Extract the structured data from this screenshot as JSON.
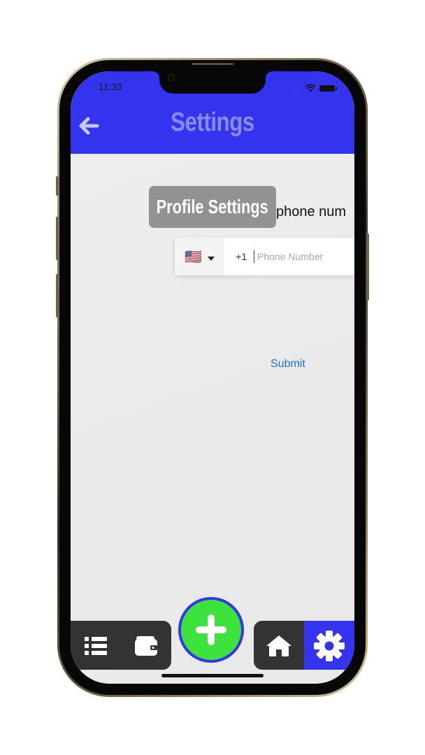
{
  "status_bar": {
    "time": "11:33",
    "signal_dots": "....",
    "wifi_icon": "wifi-icon",
    "battery_icon": "battery-icon"
  },
  "header": {
    "title": "Settings",
    "back_icon": "back-arrow-icon"
  },
  "content": {
    "tooltip": "Profile Settings",
    "prompt_text": "phone num",
    "phone_field": {
      "country_flag": "🇺🇸",
      "dial_code": "+1",
      "placeholder": "Phone Number",
      "value": ""
    },
    "submit_label": "Submit"
  },
  "bottom_nav": {
    "items": [
      {
        "icon": "list-icon",
        "active": false
      },
      {
        "icon": "wallet-icon",
        "active": false
      },
      {
        "icon": "plus-icon",
        "active": false
      },
      {
        "icon": "home-icon",
        "active": false
      },
      {
        "icon": "gear-icon",
        "active": true
      }
    ]
  },
  "colors": {
    "header": "#3434ee",
    "title": "#8a8aea",
    "fab": "#3de23d",
    "nav_dark": "#333333",
    "link": "#1f6fd8"
  }
}
